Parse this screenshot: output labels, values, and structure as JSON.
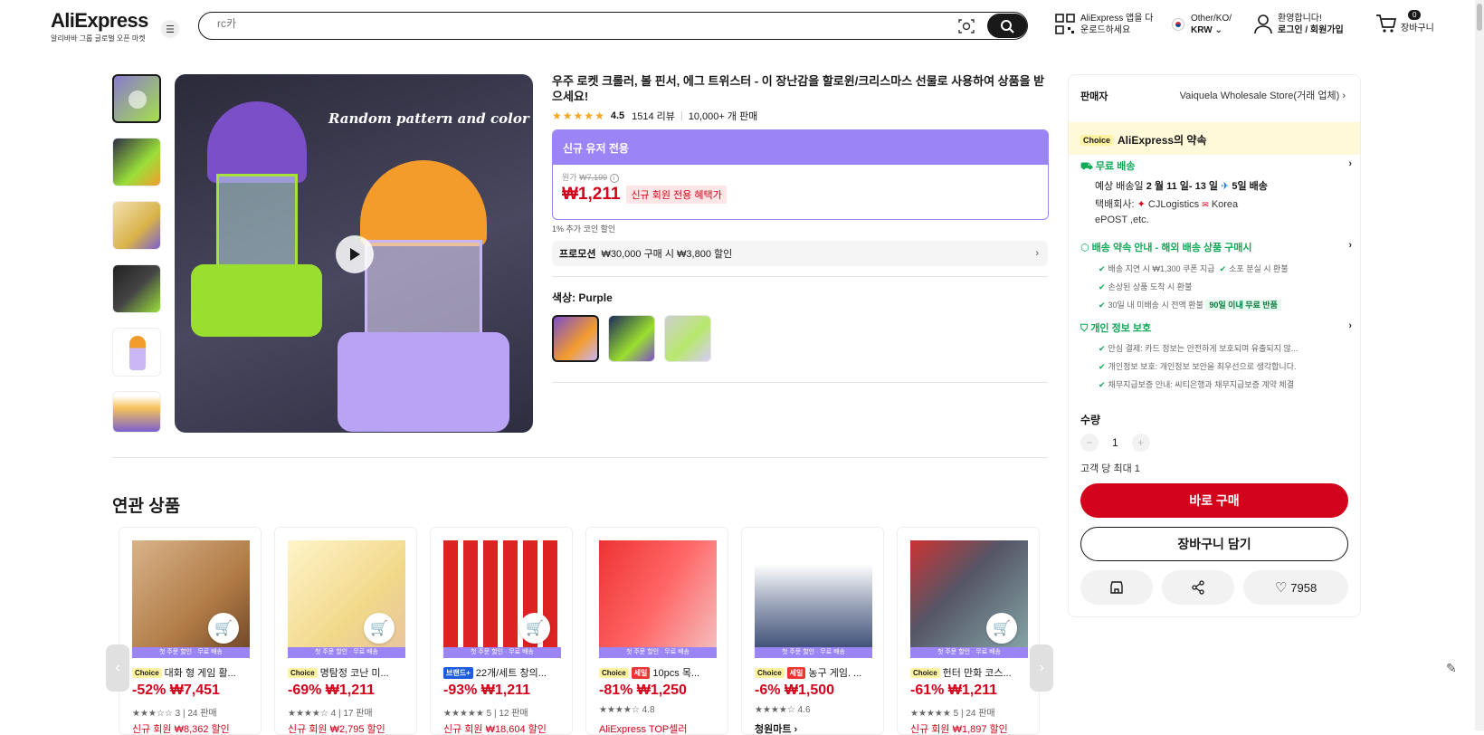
{
  "header": {
    "logo": "AliExpress",
    "logo_sub": "알리바바 그룹 글로벌 오픈 마켓",
    "search_placeholder": "rc카",
    "app_line1": "AliExpress 앱을 다",
    "app_line2": "운로드하세요",
    "region_line1": "Other/KO/",
    "region_line2": "KRW",
    "account_line1": "환영합니다!",
    "account_line2": "로그인 / 회원가입",
    "cart_count": "0",
    "cart_label": "장바구니"
  },
  "product": {
    "image_caption": "Random pattern and color",
    "title": "우주 로켓 크롤러, 볼 핀서, 에그 트위스터 - 이 장난감을 할로윈/크리스마스 선물로 사용하여 상품을 받으세요!",
    "rating": "4.5",
    "reviews": "1514 리뷰",
    "sold": "10,000+ 개 판매",
    "banner": "신규 유저 전용",
    "orig_label": "원가",
    "orig_price": "₩7,199",
    "price": "₩1,211",
    "price_badge": "신규 회원 전용 혜택가",
    "coin_note": "1% 추가 코인 할인",
    "promo_label": "프로모션",
    "promo_text": "₩30,000 구매 시 ₩3,800 할인",
    "color_label": "색상:",
    "color_value": "Purple"
  },
  "panel": {
    "seller_label": "판매자",
    "seller_name": "Vaiquela Wholesale Store(거래 업체)",
    "choice_tag": "Choice",
    "promise": "AliExpress의 약속",
    "free_ship": "무료 배송",
    "delivery_prefix": "예상 배송일",
    "delivery_dates": "2 월 11 일- 13 일",
    "delivery_fast": "5일 배송",
    "carrier_label": "택배회사:",
    "carrier_1": "CJLogistics",
    "carrier_2": "Korea",
    "carrier_3": "ePOST ,etc.",
    "guarantee_title": "배송 약속 안내 - 해외 배송 상품 구매시",
    "g1": "배송 지연 시 ₩1,300 쿠폰 지급",
    "g2": "소포 분실 시 환불",
    "g3": "손상된 상품 도착 시 환불",
    "g4": "30일 내 미배송 시 전액 환불",
    "g4_badge": "90일 이내 무료 반품",
    "privacy_title": "개인 정보 보호",
    "p1": "안심 결제: 카드 정보는 안전하게 보호되며 유출되지 않...",
    "p2": "개인정보 보호: 개인정보 보안을 최우선으로 생각합니다.",
    "p3": "채무지급보증 안내: 씨티은행과 채무지급보증 계약 체결",
    "qty_label": "수량",
    "qty_value": "1",
    "qty_limit": "고객 당 최대 1",
    "buy_now": "바로 구매",
    "add_cart": "장바구니 담기",
    "wish_count": "7958"
  },
  "related": {
    "title": "연관 상품",
    "band": "첫 주문 할인 · 무료 배송",
    "items": [
      {
        "tag": "Choice",
        "tag2": "",
        "name": "대화 형 게임 활...",
        "price": "-52% ₩7,451",
        "rating": "★★★☆☆ 3 | 24 판매",
        "coupon": "신규 회원 ₩8,362 할인"
      },
      {
        "tag": "Choice",
        "tag2": "",
        "name": "명탐정 코난 미...",
        "price": "-69% ₩1,211",
        "rating": "★★★★☆ 4 | 17 판매",
        "coupon": "신규 회원 ₩2,795 할인"
      },
      {
        "tag": "브랜드+",
        "tag2": "",
        "name": "22개/세트 창의...",
        "price": "-93% ₩1,211",
        "rating": "★★★★★ 5 | 12 판매",
        "coupon": "신규 회원 ₩18,604 할인"
      },
      {
        "tag": "Choice",
        "tag2": "세일",
        "name": "10pcs 목...",
        "price": "-81% ₩1,250",
        "rating": "★★★★☆ 4.8",
        "coupon": "AliExpress TOP셀러"
      },
      {
        "tag": "Choice",
        "tag2": "세일",
        "name": "농구 게임. ...",
        "price": "-6% ₩1,500",
        "rating": "★★★★☆ 4.6",
        "coupon": "청원마트 ›"
      },
      {
        "tag": "Choice",
        "tag2": "",
        "name": "헌터 만화 코스...",
        "price": "-61% ₩1,211",
        "rating": "★★★★★ 5 | 24 판매",
        "coupon": "신규 회원 ₩1,897 할인"
      }
    ]
  },
  "colors": {
    "accent": "#d3031c",
    "choice_purple": "#9b84f5",
    "green": "#0fa958"
  }
}
